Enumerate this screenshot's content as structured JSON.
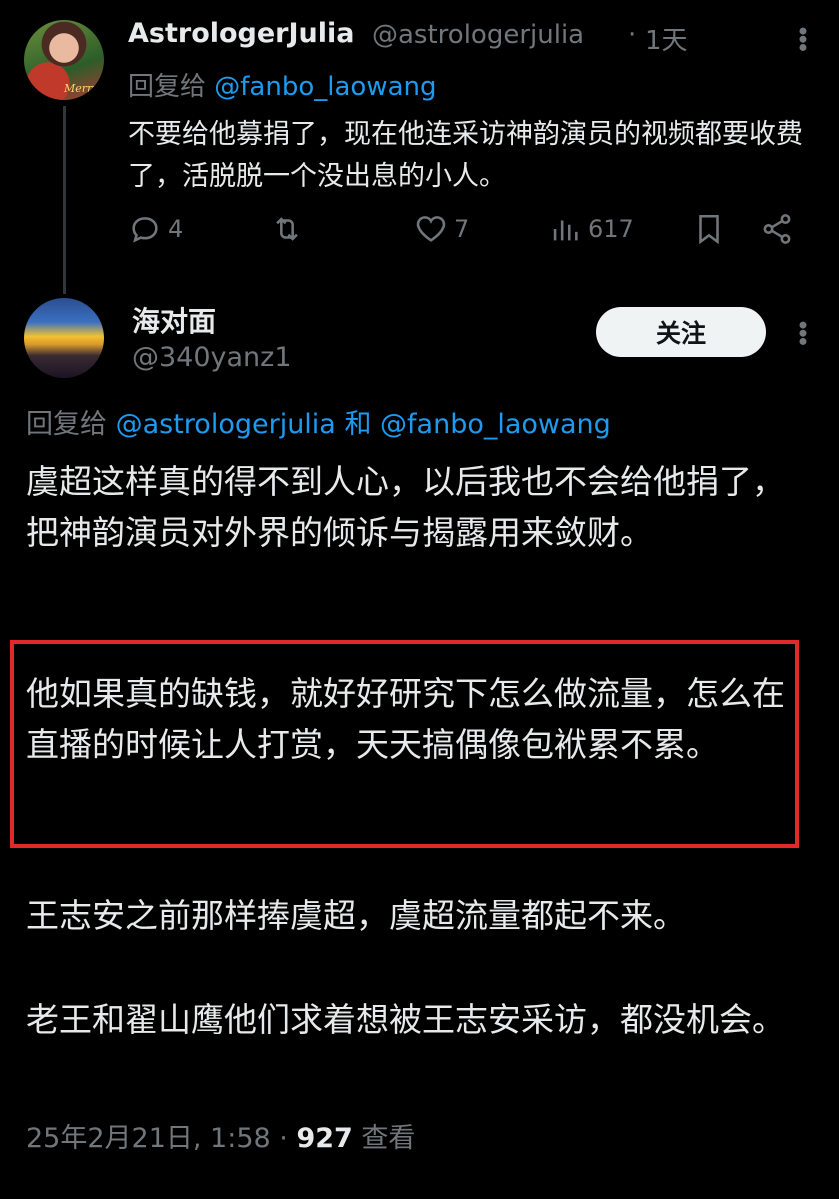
{
  "tweet1": {
    "display_name": "AstrologerJulia",
    "handle": "@astrologerjulia",
    "separator": "·",
    "time": "1天",
    "reply_prefix": "回复给",
    "reply_to": "@fanbo_laowang",
    "text": "不要给他募捐了，现在他连采访神韵演员的视频都要收费了，活脱脱一个没出息的小人。",
    "avatar_text": "Merry",
    "replies": "4",
    "retweets": "",
    "likes": "7",
    "views": "617"
  },
  "tweet2": {
    "display_name": "海对面",
    "handle": "@340yanz1",
    "follow_label": "关注",
    "reply_prefix": "回复给",
    "reply_to_1": "@astrologerjulia",
    "reply_joiner": "和",
    "reply_to_2": "@fanbo_laowang",
    "paragraphs": [
      "虞超这样真的得不到人心，以后我也不会给他捐了，把神韵演员对外界的倾诉与揭露用来敛财。",
      "他如果真的缺钱，就好好研究下怎么做流量，怎么在直播的时候让人打赏，天天搞偶像包袱累不累。",
      "王志安之前那样捧虞超，虞超流量都起不来。",
      "老王和翟山鹰他们求着想被王志安采访，都没机会。"
    ],
    "timestamp": "25年2月21日, 1:58",
    "dot": " · ",
    "view_count": "927",
    "view_label": "查看"
  },
  "colors": {
    "background": "#000000",
    "text": "#e7e9ea",
    "muted": "#71767b",
    "link": "#1d9bf0",
    "highlight_box": "#e02a2a"
  }
}
